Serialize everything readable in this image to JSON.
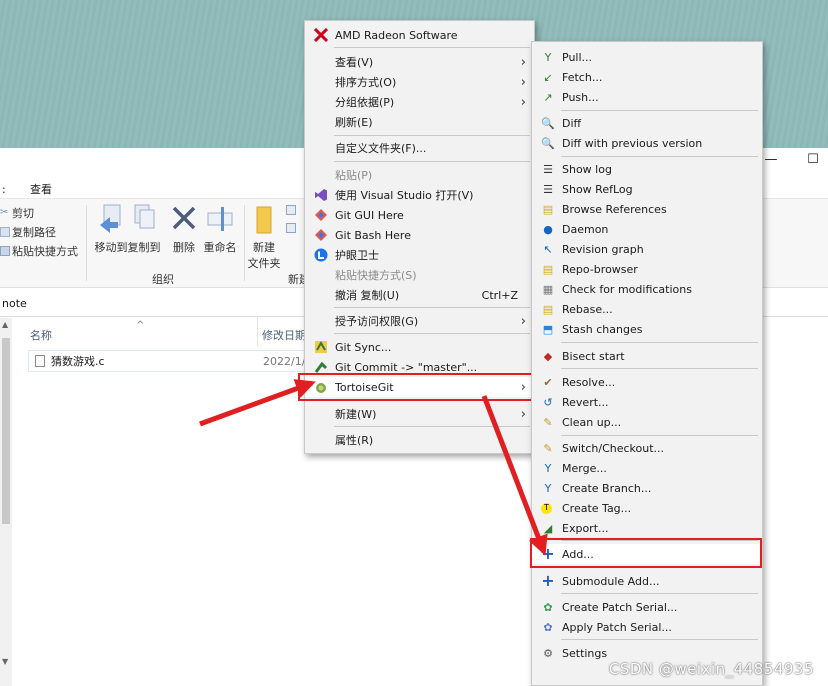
{
  "window": {
    "maximize": "☐",
    "minimize": "—"
  },
  "ribbon": {
    "tab": "查看",
    "cut": "剪切",
    "copy_path": "复制路径",
    "paste_shortcut": "粘贴快捷方式",
    "move_to": "移动到",
    "copy_to": "复制到",
    "delete": "删除",
    "rename": "重命名",
    "new_folder": "新建\n文件夹",
    "new_folder_line1": "新建",
    "new_folder_line2": "文件夹",
    "group_organize": "组织",
    "group_new": "新建"
  },
  "address": {
    "path": "note"
  },
  "file_list": {
    "col_name": "名称",
    "col_modified": "修改日期",
    "files": [
      {
        "name": "猜数游戏.c",
        "modified": "2022/1/"
      }
    ]
  },
  "context_menu": {
    "items": [
      {
        "label": "AMD Radeon Software",
        "icon": "amd-radeon-icon"
      },
      {
        "label": "查看(V)",
        "submenu": true
      },
      {
        "label": "排序方式(O)",
        "submenu": true
      },
      {
        "label": "分组依据(P)",
        "submenu": true
      },
      {
        "label": "刷新(E)"
      },
      {
        "label": "自定义文件夹(F)..."
      },
      {
        "label": "粘贴(P)",
        "disabled": true
      },
      {
        "label": "使用 Visual Studio 打开(V)",
        "icon": "visual-studio-icon"
      },
      {
        "label": "Git GUI Here",
        "icon": "git-gui-icon"
      },
      {
        "label": "Git Bash Here",
        "icon": "git-bash-icon"
      },
      {
        "label": "护眼卫士",
        "icon": "eye-guard-icon"
      },
      {
        "label": "粘贴快捷方式(S)",
        "disabled": true
      },
      {
        "label": "撤消 复制(U)",
        "shortcut": "Ctrl+Z"
      },
      {
        "label": "授予访问权限(G)",
        "submenu": true
      },
      {
        "label": "Git Sync...",
        "icon": "git-sync-icon"
      },
      {
        "label": "Git Commit -> \"master\"...",
        "icon": "git-commit-icon"
      },
      {
        "label": "TortoiseGit",
        "icon": "tortoisegit-icon",
        "submenu": true,
        "highlighted": true
      },
      {
        "label": "新建(W)",
        "submenu": true
      },
      {
        "label": "属性(R)"
      }
    ]
  },
  "tortoise_menu": {
    "items": [
      {
        "label": "Pull...",
        "icon": "pull-icon"
      },
      {
        "label": "Fetch...",
        "icon": "fetch-icon"
      },
      {
        "label": "Push...",
        "icon": "push-icon"
      },
      {
        "label": "Diff",
        "icon": "diff-icon"
      },
      {
        "label": "Diff with previous version",
        "icon": "diff-previous-icon"
      },
      {
        "label": "Show log",
        "icon": "show-log-icon"
      },
      {
        "label": "Show RefLog",
        "icon": "show-reflog-icon"
      },
      {
        "label": "Browse References",
        "icon": "browse-references-icon"
      },
      {
        "label": "Daemon",
        "icon": "daemon-icon"
      },
      {
        "label": "Revision graph",
        "icon": "revision-graph-icon"
      },
      {
        "label": "Repo-browser",
        "icon": "repo-browser-icon"
      },
      {
        "label": "Check for modifications",
        "icon": "check-modifications-icon"
      },
      {
        "label": "Rebase...",
        "icon": "rebase-icon"
      },
      {
        "label": "Stash changes",
        "icon": "stash-icon"
      },
      {
        "label": "Bisect start",
        "icon": "bisect-icon"
      },
      {
        "label": "Resolve...",
        "icon": "resolve-icon"
      },
      {
        "label": "Revert...",
        "icon": "revert-icon"
      },
      {
        "label": "Clean up...",
        "icon": "clean-up-icon"
      },
      {
        "label": "Switch/Checkout...",
        "icon": "switch-checkout-icon"
      },
      {
        "label": "Merge...",
        "icon": "merge-icon"
      },
      {
        "label": "Create Branch...",
        "icon": "create-branch-icon"
      },
      {
        "label": "Create Tag...",
        "icon": "create-tag-icon"
      },
      {
        "label": "Export...",
        "icon": "export-icon"
      },
      {
        "label": "Add...",
        "icon": "add-icon",
        "highlighted": true
      },
      {
        "label": "Submodule Add...",
        "icon": "submodule-add-icon"
      },
      {
        "label": "Create Patch Serial...",
        "icon": "create-patch-icon"
      },
      {
        "label": "Apply Patch Serial...",
        "icon": "apply-patch-icon"
      },
      {
        "label": "Settings",
        "icon": "settings-icon"
      }
    ]
  },
  "watermark": "CSDN @weixin_44854935",
  "colors": {
    "highlight_border": "#e02020",
    "arrow": "#e02020",
    "desktop": "#8fbbba"
  }
}
